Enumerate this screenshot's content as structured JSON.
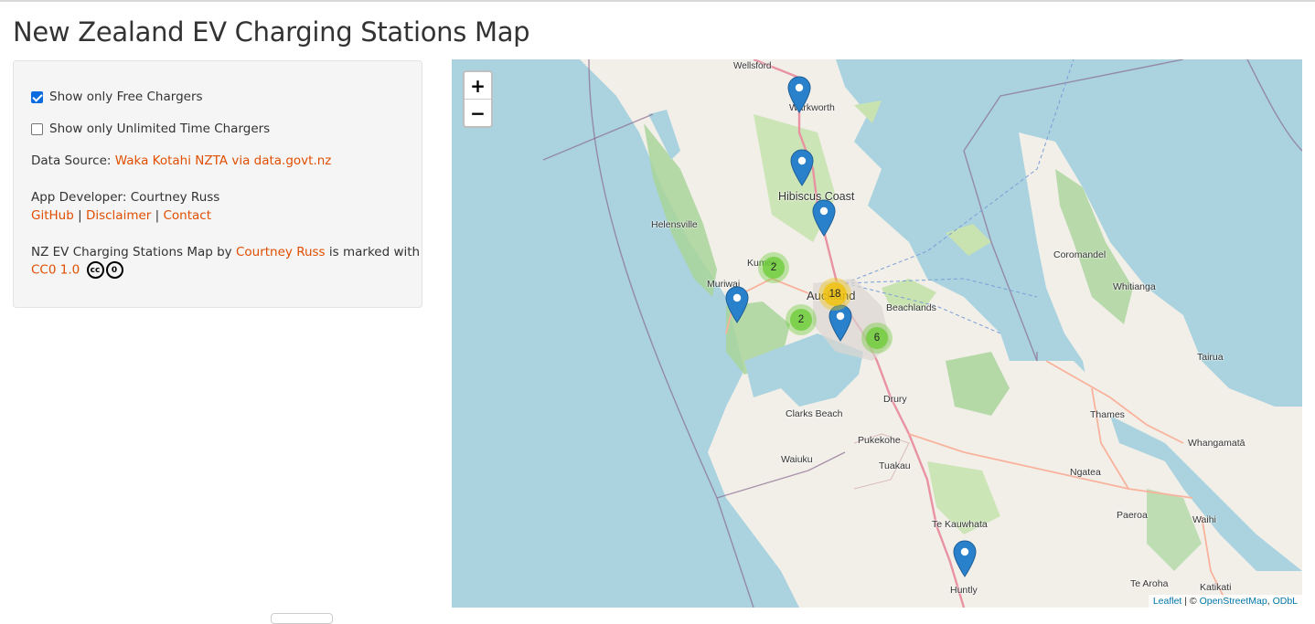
{
  "page": {
    "title": "New Zealand EV Charging Stations Map"
  },
  "filters": {
    "free_label": "Show only Free Chargers",
    "free_checked": true,
    "unlimited_label": "Show only Unlimited Time Chargers",
    "unlimited_checked": false
  },
  "info": {
    "data_source_prefix": "Data Source:",
    "data_source_link": "Waka Kotahi NZTA via data.govt.nz",
    "developer": "App Developer: Courtney Russ",
    "github": "GitHub",
    "disclaimer": "Disclaimer",
    "contact": "Contact",
    "separator": "|",
    "license_prefix": "NZ EV Charging Stations Map by",
    "license_author": "Courtney Russ",
    "license_suffix": "is marked with",
    "license_link": "CC0 1.0",
    "cc_icon_text": "cc",
    "zero_icon_text": "0"
  },
  "map": {
    "zoom_in": "+",
    "zoom_out": "−",
    "attribution": {
      "leaflet": "Leaflet",
      "separator": "| ©",
      "osm": "OpenStreetMap",
      "odbl": "ODbL"
    },
    "place_labels": [
      "Wellsford",
      "Warkworth",
      "Hibiscus Coast",
      "Helensville",
      "Kumeu",
      "Muriwai",
      "Auckland",
      "Beachlands",
      "Coromandel",
      "Whitianga",
      "Tairua",
      "Thames",
      "Drury",
      "Clarks Beach",
      "Pukekohe",
      "Waiuku",
      "Tuakau",
      "Ngatea",
      "Whangamatā",
      "Paeroa",
      "Waihi",
      "Te Kauwhata",
      "Huntly",
      "Te Aroha",
      "Katikati"
    ],
    "clusters": [
      {
        "count": "2",
        "color": "#6ecc39"
      },
      {
        "count": "18",
        "color": "#f0c20c"
      },
      {
        "count": "2",
        "color": "#6ecc39"
      },
      {
        "count": "6",
        "color": "#6ecc39"
      }
    ],
    "marker_count": 6,
    "colors": {
      "water": "#aad3df",
      "land": "#f2efe9",
      "park": "#c8e3b0",
      "forest": "#a9d59b",
      "motorway": "#e892a2",
      "trunk": "#f9b29c",
      "boundary": "#8a6b8f",
      "marker": "#2a81cb"
    }
  }
}
